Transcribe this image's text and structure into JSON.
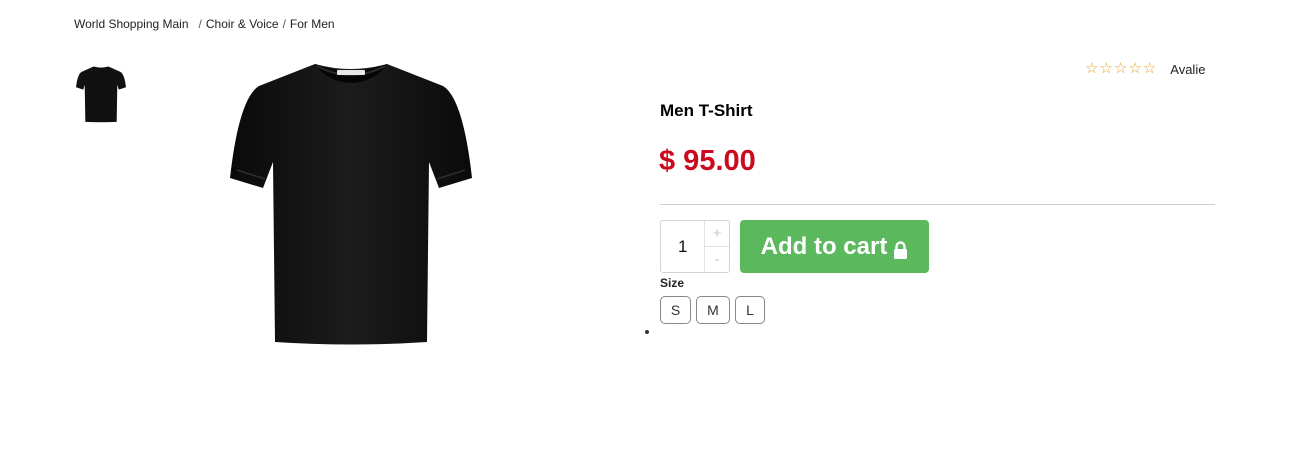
{
  "breadcrumb": {
    "home": "World Shopping Main",
    "sep1": "/",
    "category": "Choir & Voice",
    "sep2": "/",
    "current": "For Men"
  },
  "product": {
    "title": "Men T-Shirt",
    "price": "$ 95.00",
    "rating": {
      "stars": 0,
      "max": 5,
      "reviews_label": "Avalie"
    },
    "image_icon": "black-tshirt-photo",
    "thumbnail_icon": "black-tshirt-thumbnail"
  },
  "purchase": {
    "quantity": "1",
    "increment": "+",
    "decrement": "-",
    "add_to_cart": "Add to cart",
    "cart_icon": "lock-icon"
  },
  "size": {
    "label": "Size",
    "options": [
      "S",
      "M",
      "L"
    ]
  },
  "colors": {
    "price": "#cc0a1e",
    "cart_button": "#5cb85c",
    "stars": "#e0a32a"
  }
}
